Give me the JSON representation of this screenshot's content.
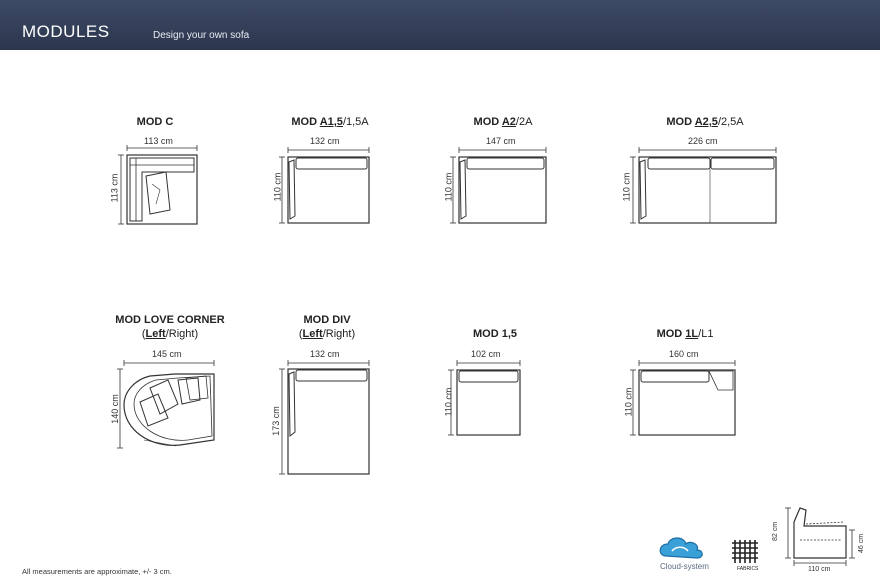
{
  "header": {
    "title": "MODULES",
    "subtitle": "Design your own sofa"
  },
  "modules": [
    {
      "id": "mod-c",
      "name": "MOD C",
      "width": "113 cm",
      "depth": "113 cm"
    },
    {
      "id": "mod-a15",
      "name_prefix": "MOD ",
      "name_main": "A1,5",
      "name_rest": "/1,5A",
      "width": "132 cm",
      "depth": "110 cm"
    },
    {
      "id": "mod-a2",
      "name_prefix": "MOD ",
      "name_main": "A2",
      "name_rest": "/2A",
      "width": "147 cm",
      "depth": "110 cm"
    },
    {
      "id": "mod-a25",
      "name_prefix": "MOD ",
      "name_main": "A2,5",
      "name_rest": "/2,5A",
      "width": "226 cm",
      "depth": "110 cm"
    },
    {
      "id": "mod-love",
      "name": "MOD LOVE CORNER",
      "sub_open": "(",
      "sub_main": "Left",
      "sub_rest": "/Right)",
      "width": "145 cm",
      "depth": "140 cm"
    },
    {
      "id": "mod-div",
      "name": "MOD DIV",
      "sub_open": "(",
      "sub_main": "Left",
      "sub_rest": "/Right)",
      "width": "132 cm",
      "depth": "173 cm"
    },
    {
      "id": "mod-15",
      "name": "MOD 1,5",
      "width": "102 cm",
      "depth": "110 cm"
    },
    {
      "id": "mod-1l",
      "name_prefix": "MOD ",
      "name_main": "1L",
      "name_rest": "/L1",
      "width": "160 cm",
      "depth": "110 cm"
    }
  ],
  "footer": {
    "note": "All measurements are approximate, +/- 3 cm.",
    "brand_cloud": "Cloud-system",
    "brand_fabrics": "FABRICS",
    "side_height": "82 cm",
    "seat_height": "46 cm",
    "side_depth": "110 cm"
  }
}
